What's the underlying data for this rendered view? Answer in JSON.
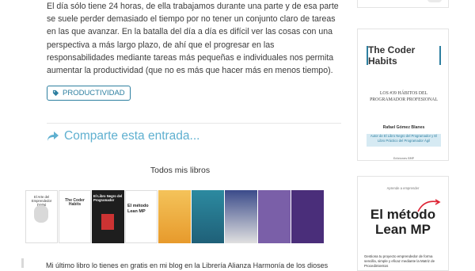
{
  "article": {
    "paragraph": "El día sólo tiene 24 horas, de ella trabajamos durante una parte y de esa parte se suele perder demasiado el tiempo por no tener un conjunto claro de tareas en las que avanzar. En la batalla del día a día es difícil ver las cosas con una perspectiva a más largo plazo, de ahí que el progresar en las responsabilidades mediante tareas más pequeñas e individuales nos permita aumentar la productividad (que no es más que hacer más en menos tiempo).",
    "tag": "PRODUCTIVIDAD",
    "share": "Comparte esta entrada...",
    "books_title": "Todos mis libros",
    "bottom_text": "Mi último libro lo tienes en gratis en mi blog en la Librería Alianza Harmonía de los dioses"
  },
  "books": [
    {
      "title": "El Arte del Emprendedor Digital"
    },
    {
      "title": "The Coder Habits"
    },
    {
      "title": "El Libro Negro del Programador"
    },
    {
      "title": "El método Lean MP"
    },
    {
      "title": ""
    },
    {
      "title": ""
    },
    {
      "title": ""
    },
    {
      "title": ""
    },
    {
      "title": ""
    }
  ],
  "sidebar": {
    "coder_habits": {
      "title": "The Coder Habits",
      "subtitle": "LOS #39 HÁBITOS DEL PROGRAMADOR PROFESIONAL",
      "author": "Rafael Gómez Blanes",
      "note": "Autor de El Libro Negro del Programador y El Libro Práctico del Programador Ágil",
      "edition": "Ediciones BMP"
    },
    "lean_mp": {
      "small": "Aprende a emprender",
      "title": "El método Lean MP",
      "desc": "Gestiona tu proyecto emprendedor de forma sencilla, simple y eficaz mediante la Matriz de Procedimientos"
    }
  },
  "colors": {
    "accent": "#2d7fa0",
    "share": "#5fb0d0"
  }
}
